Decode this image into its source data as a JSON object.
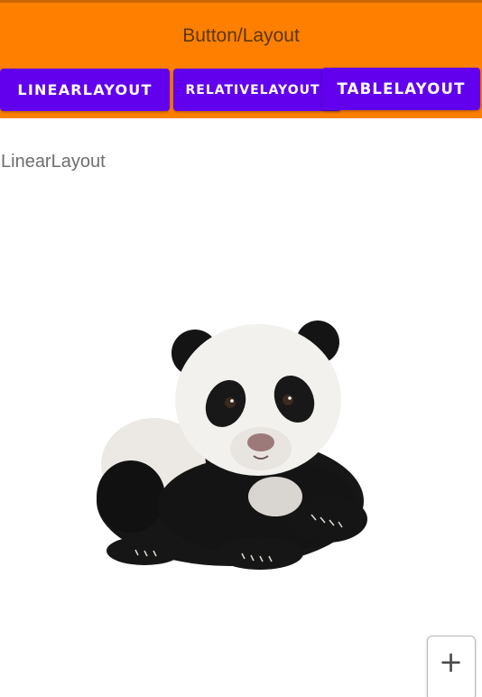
{
  "app_bar": {
    "title": "Button/Layout",
    "color": "#ff8000"
  },
  "buttons": [
    {
      "label": "LINEARLAYOUT"
    },
    {
      "label": "RELATIVELAYOUT"
    },
    {
      "label": "TABLELAYOUT"
    }
  ],
  "button_color": "#6200ee",
  "content": {
    "section_label": "LinearLayout",
    "image": "panda-image"
  },
  "fab": {
    "icon": "plus-icon",
    "symbol": "+"
  }
}
